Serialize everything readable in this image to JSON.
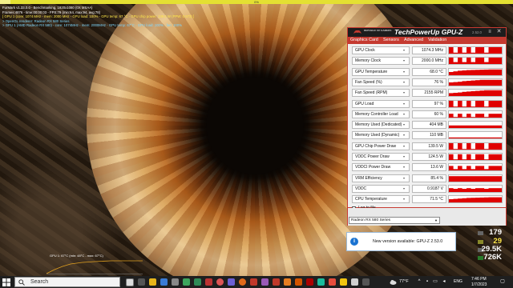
{
  "furmark": {
    "progress_fraction": 0.02,
    "progress_label": "0%",
    "osd": [
      {
        "text": "FurMark v1.33.0.0 - Benchmarking, 1920x1080 (0X MSAA)",
        "color": "white"
      },
      {
        "text": "Frames:4876 - time:00:00:03 - FPS:79 (min:64, max:94, avg:78)",
        "color": "white"
      },
      {
        "text": "[ GPU 1 (core: 1074 MHz - mem: 2000 MHz - GPU load: 100% - GPU temp: 67 °C - GPU chip power: 139.5 W (PPW: 0.573) ]",
        "color": "yellow"
      },
      {
        "text": "> OpenGL renderer: Radeon RX 580 Series",
        "color": "cyan"
      },
      {
        "text": "> GPU 1 (AMD Radeon RX 580) - core: 1074MHz - mem: 2000MHz - GPU temp: 67°C - GPU load: 100% - fan: 100%",
        "color": "cyan"
      }
    ],
    "mini_graph_label": "GPU 1: 67°C (min: 48°C - max: 67°C)"
  },
  "gpuz": {
    "rog_text": "REPUBLIC OF GAMERS",
    "title": "TechPowerUp GPU-Z",
    "version": "2.52.0",
    "menu_icon": "≡",
    "close_icon": "✕",
    "tabs": [
      "Graphics Card",
      "Sensors",
      "Advanced",
      "Validation"
    ],
    "sensors": [
      {
        "name": "GPU Clock",
        "value": "1074.3 MHz"
      },
      {
        "name": "Memory Clock",
        "value": "2000.0 MHz"
      },
      {
        "name": "GPU Temperature",
        "value": "68.0 °C"
      },
      {
        "name": "Fan Speed (%)",
        "value": "76 %"
      },
      {
        "name": "Fan Speed (RPM)",
        "value": "2155 RPM"
      },
      {
        "name": "GPU Load",
        "value": "97 %"
      },
      {
        "name": "Memory Controller Load",
        "value": "60 %"
      },
      {
        "name": "Memory Used (Dedicated)",
        "value": "404 MB"
      },
      {
        "name": "Memory Used (Dynamic)",
        "value": "110 MB"
      },
      {
        "name": "GPU Chip Power Draw",
        "value": "139.5 W"
      },
      {
        "name": "VDDC Power Draw",
        "value": "124.5 W"
      },
      {
        "name": "VDDCI Power Draw",
        "value": "13.6 W"
      },
      {
        "name": "VRM Efficiency",
        "value": "85.4 %"
      },
      {
        "name": "VDDC",
        "value": "0.9187 V"
      },
      {
        "name": "CPU Temperature",
        "value": "71.5 °C"
      }
    ],
    "log_label": "Log to file",
    "selected_gpu": "Radeon RX 580 Series"
  },
  "notification": {
    "icon": "i",
    "text": "New version available: GPU-Z 2.53.0"
  },
  "fps_overlay": [
    "179",
    "29",
    "29.5K",
    "726K"
  ],
  "taskbar": {
    "search_placeholder": "Search",
    "weather": "77°F",
    "language": "ENG",
    "time": "7:46 PM",
    "date": "1/7/2023"
  },
  "colors": {
    "accent_red": "#c53a30",
    "graph_red": "#e00000",
    "osd_yellow": "#ffe84a",
    "osd_cyan": "#7fd8ff"
  }
}
